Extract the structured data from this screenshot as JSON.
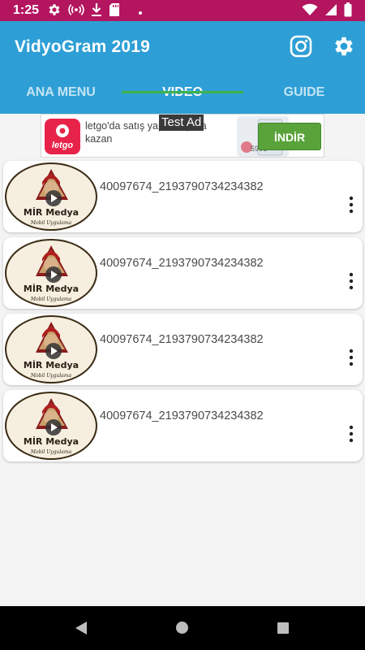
{
  "status_bar": {
    "time": "1:25",
    "color": "#b3155f",
    "icons": [
      "settings-icon",
      "broadcast-icon",
      "download-icon",
      "sd-card-icon",
      "dot-icon",
      "wifi-icon",
      "signal-icon",
      "battery-icon"
    ]
  },
  "app_bar": {
    "title": "VidyoGram 2019",
    "color": "#2e9fd6",
    "actions": [
      "instagram-icon",
      "settings-icon"
    ]
  },
  "tabs": [
    {
      "label": "ANA MENU",
      "active": false
    },
    {
      "label": "VIDEO",
      "active": true
    },
    {
      "label": "GUIDE",
      "active": false
    }
  ],
  "ad": {
    "label": "Test Ad",
    "brand": "letgo",
    "text": "letgo'da satış yaparak para kazan",
    "price": "590₺",
    "button": "İNDİR"
  },
  "videos": [
    {
      "title": "40097674_2193790734234382",
      "thumb_text": "MİR Medya",
      "thumb_subtext": "Mobil Uygulama"
    },
    {
      "title": "40097674_2193790734234382",
      "thumb_text": "MİR Medya",
      "thumb_subtext": "Mobil Uygulama"
    },
    {
      "title": "40097674_2193790734234382",
      "thumb_text": "MİR Medya",
      "thumb_subtext": "Mobil Uygulama"
    },
    {
      "title": "40097674_2193790734234382",
      "thumb_text": "MİR Medya",
      "thumb_subtext": "Mobil Uygulama"
    }
  ],
  "nav_bar": {
    "buttons": [
      "back-icon",
      "home-icon",
      "recents-icon"
    ]
  }
}
